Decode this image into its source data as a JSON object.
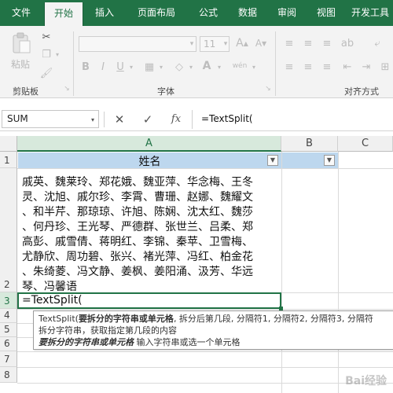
{
  "tabs": [
    "文件",
    "开始",
    "插入",
    "页面布局",
    "公式",
    "数据",
    "审阅",
    "视图",
    "开发工具"
  ],
  "ribbon": {
    "groups": {
      "clipboard": "剪贴板",
      "font": "字体",
      "alignment": "对齐方式"
    },
    "paste_label": "粘贴",
    "font_size": "11",
    "font_bold": "B",
    "font_italic": "I",
    "font_underline": "U",
    "font_color_letter": "A",
    "wen_glyph": "wén"
  },
  "formula_bar": {
    "name_box": "SUM",
    "cancel": "✕",
    "enter": "✓",
    "fx": "fx",
    "content": "=TextSplit("
  },
  "sheet": {
    "columns": [
      "A",
      "B",
      "C"
    ],
    "rows": [
      "1",
      "2",
      "3",
      "4",
      "5",
      "6",
      "7",
      "8"
    ],
    "header_cell": "姓名",
    "filter_glyph": "▼",
    "names_lines": [
      "戚英、魏莱玲、郑花娥、魏亚萍、华念梅、王冬",
      "灵、沈旭、戚尔珍、李霄、曹珊、赵娜、魏耀文",
      "、和半芹、那琼琼、许旭、陈娴、沈太红、魏莎",
      "、何丹珍、王光琴、严德群、张世兰、吕柔、郑",
      "高彭、戚雪倩、蒋明红、李锦、秦苹、卫雪梅、",
      "尤静欣、周功碧、张兴、褚光萍、冯红、柏金花",
      "、朱绮菱、冯文静、姜枫、姜阳涌、汲芳、华远",
      "琴、冯馨语"
    ],
    "editing_cell": "=TextSplit("
  },
  "tooltip": {
    "line1_prefix": "TextSplit(",
    "line1_bold": "要拆分的字符串或单元格",
    "line1_rest": ", 拆分后第几段, 分隔符1, 分隔符2, 分隔符3, 分隔符",
    "line2": "拆分字符串，获取指定第几段的内容",
    "line3_bold": "要拆分的字符串或单元格",
    "line3_rest": " 输入字符串或选一个单元格"
  },
  "watermark": "Bai经验"
}
